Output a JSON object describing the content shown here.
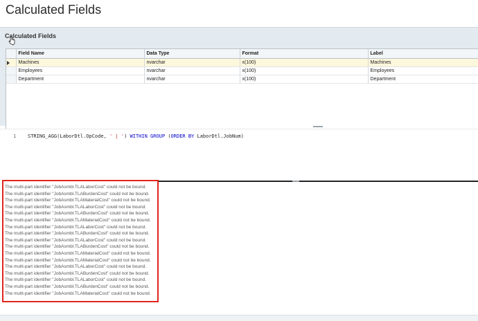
{
  "page": {
    "title": "Calculated Fields"
  },
  "panel": {
    "header": "Calculated Fields"
  },
  "grid": {
    "columns": [
      "Field Name",
      "Data Type",
      "Format",
      "Label"
    ],
    "rows": [
      [
        "Machines",
        "nvarchar",
        "x(100)",
        "Machines"
      ],
      [
        "Employees",
        "nvarchar",
        "x(100)",
        "Employees"
      ],
      [
        "Department",
        "nvarchar",
        "x(100)",
        "Department"
      ]
    ]
  },
  "editor": {
    "line_number": "1",
    "code": {
      "fn": "STRING_AGG(LaborDtl.OpCode, ",
      "str": "' | '",
      "mid": ") ",
      "kw1": "WITHIN GROUP",
      "mid2": " (",
      "kw2": "ORDER BY",
      "tail": " LaborDtl.JobNum)"
    }
  },
  "messages": [
    "The multi-part identifier \"JobAsmbl.TLALaborCost\" could not be bound.",
    "The multi-part identifier \"JobAsmbl.TLABurdenCost\" could not be bound.",
    "The multi-part identifier \"JobAsmbl.TLAMaterialCost\" could not be bound.",
    "The multi-part identifier \"JobAsmbl.TLALaborCost\" could not be bound.",
    "The multi-part identifier \"JobAsmbl.TLABurdenCost\" could not be bound.",
    "The multi-part identifier \"JobAsmbl.TLAMaterialCost\" could not be bound.",
    "The multi-part identifier \"JobAsmbl.TLALaborCost\" could not be bound.",
    "The multi-part identifier \"JobAsmbl.TLABurdenCost\" could not be bound.",
    "The multi-part identifier \"JobAsmbl.TLALaborCost\" could not be bound.",
    "The multi-part identifier \"JobAsmbl.TLABurdenCost\" could not be bound.",
    "The multi-part identifier \"JobAsmbl.TLAMaterialCost\" could not be bound.",
    "The multi-part identifier \"JobAsmbl.TLAMaterialCost\" could not be bound.",
    "The multi-part identifier \"JobAsmbl.TLALaborCost\" could not be bound.",
    "The multi-part identifier \"JobAsmbl.TLABurdenCost\" could not be bound.",
    "The multi-part identifier \"JobAsmbl.TLALaborCost\" could not be bound.",
    "The multi-part identifier \"JobAsmbl.TLABurdenCost\" could not be bound.",
    "The multi-part identifier \"JobAsmbl.TLAMaterialCost\" could not be bound."
  ],
  "colors": {
    "error_border": "#e0231c",
    "selected_row": "#fdf7dc",
    "panel_bg": "#e4ebf0",
    "keyword": "#0000cc",
    "string": "#b22222"
  },
  "icons": {
    "cursor": "hand-cursor-icon",
    "row_indicator": "row-pointer-icon"
  }
}
